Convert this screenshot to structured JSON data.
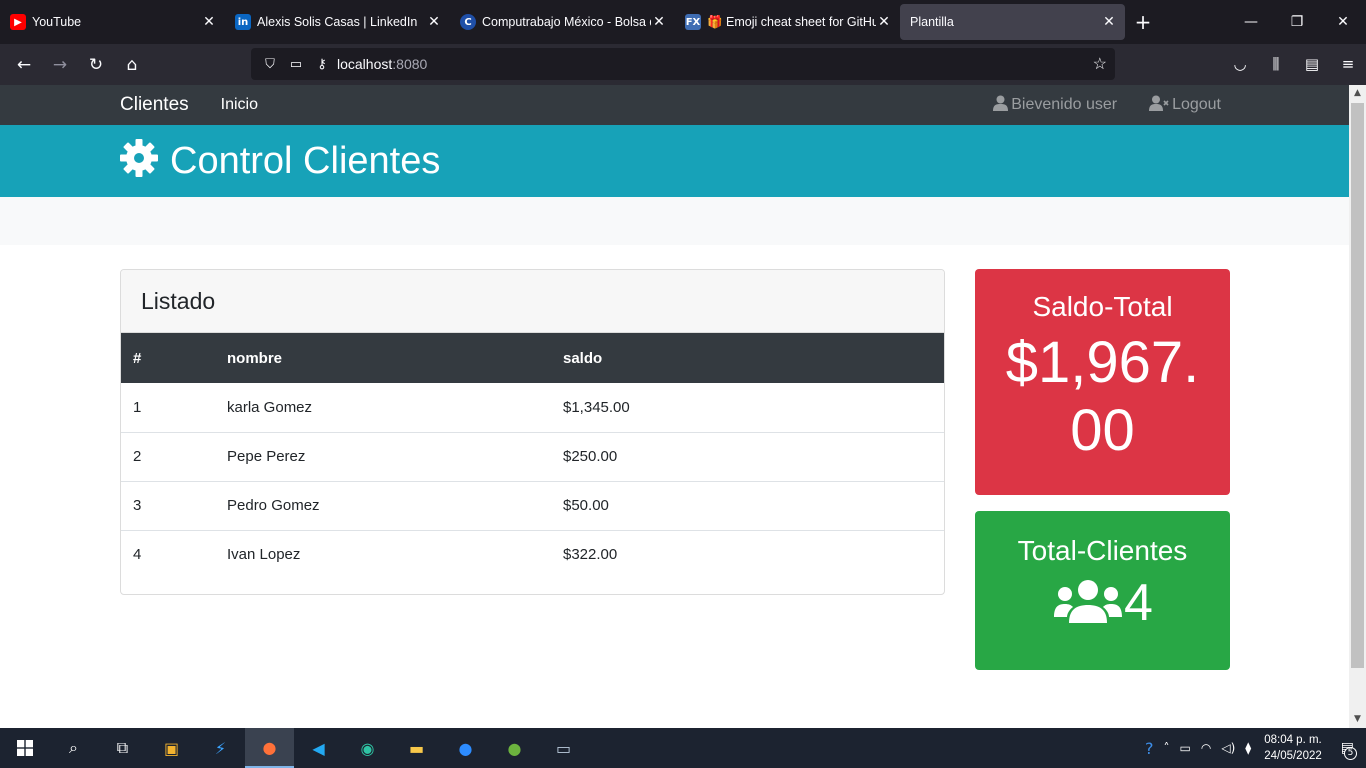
{
  "browser": {
    "tabs": [
      {
        "title": "YouTube",
        "favicon": "youtube-icon",
        "color": "#ff0000"
      },
      {
        "title": "Alexis Solis Casas | LinkedIn",
        "favicon": "linkedin-icon",
        "color": "#0a66c2"
      },
      {
        "title": "Computrabajo México - Bolsa de",
        "favicon": "computrabajo-icon",
        "color": "#1f4fa8"
      },
      {
        "title": "🎁 Emoji cheat sheet for GitHub",
        "favicon": "fx-icon",
        "color": "#3f6db3"
      },
      {
        "title": "Plantilla",
        "favicon": "",
        "color": ""
      }
    ],
    "url_host": "localhost",
    "url_port": ":8080"
  },
  "nav": {
    "brand": "Clientes",
    "link_inicio": "Inicio",
    "welcome": "Bievenido user",
    "logout": "Logout"
  },
  "hero": {
    "title": "Control Clientes"
  },
  "listado": {
    "title": "Listado",
    "columns": [
      "#",
      "nombre",
      "saldo"
    ],
    "rows": [
      {
        "id": "1",
        "nombre": "karla Gomez",
        "saldo": "$1,345.00"
      },
      {
        "id": "2",
        "nombre": "Pepe Perez",
        "saldo": "$250.00"
      },
      {
        "id": "3",
        "nombre": "Pedro Gomez",
        "saldo": "$50.00"
      },
      {
        "id": "4",
        "nombre": "Ivan Lopez",
        "saldo": "$322.00"
      }
    ]
  },
  "saldo": {
    "title": "Saldo-Total",
    "value": "$1,967.00"
  },
  "clientes": {
    "title": "Total-Clientes",
    "value": "4"
  },
  "taskbar": {
    "time": "08:04 p. m.",
    "date": "24/05/2022",
    "notifications": "5"
  },
  "colors": {
    "navbar": "#343a40",
    "hero": "#17a2b8",
    "danger": "#dc3545",
    "success": "#28a745"
  }
}
